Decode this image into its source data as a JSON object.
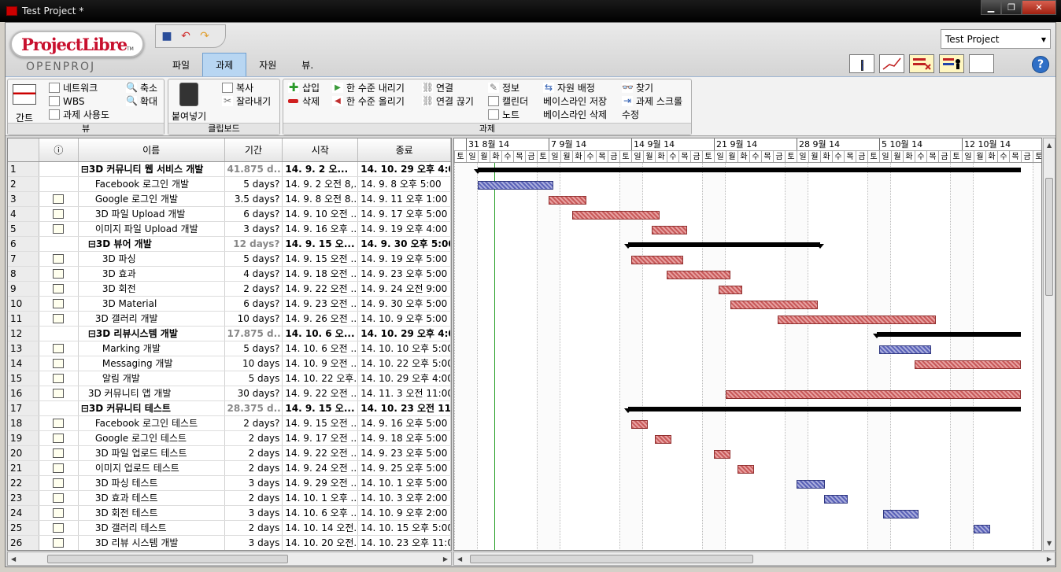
{
  "window": {
    "title": "Test Project *",
    "min": "▁",
    "max": "❐",
    "close": "✕"
  },
  "logo": {
    "name": "ProjectLibre",
    "tm": "TM",
    "sub": "OPENPROJ"
  },
  "tabs": [
    {
      "label": "파일"
    },
    {
      "label": "과제"
    },
    {
      "label": "자원"
    },
    {
      "label": "뷰."
    }
  ],
  "project_selector": {
    "value": "Test Project"
  },
  "help_label": "?",
  "ribbon": {
    "view_group": {
      "label": "뷰",
      "gantt": "간트",
      "network": "네트워크",
      "wbs": "WBS",
      "task_usage": "과제 사용도",
      "zoom_out": "축소",
      "zoom_in": "확대"
    },
    "clipboard_group": {
      "label": "클립보드",
      "paste": "붙여넣기",
      "copy": "복사",
      "cut": "잘라내기"
    },
    "task_group": {
      "label": "과제",
      "insert": "삽입",
      "delete": "삭제",
      "indent": "한 수준 내리기",
      "outdent": "한 수준 올리기",
      "link": "연결",
      "unlink": "연결 끊기",
      "info": "정보",
      "calendar": "캘린더",
      "notes": "노트",
      "assign": "자원 배정",
      "save_baseline": "베이스라인 저장",
      "clear_baseline": "베이스라인 삭제",
      "find": "찾기",
      "scroll_to_task": "과제 스크롤",
      "edit": "수정"
    }
  },
  "table": {
    "headers": {
      "info": "ⓘ",
      "name": "이름",
      "duration": "기간",
      "start": "시작",
      "finish": "종료"
    },
    "rows": [
      {
        "id": "1",
        "name": "⊟3D 커뮤니티 웹 서비스 개발",
        "duration": "41.875 d...",
        "start": "14. 9. 2 오...",
        "finish": "14. 10. 29 오후 4:0",
        "summary": true,
        "indent": 0,
        "note": false
      },
      {
        "id": "2",
        "name": "Facebook 로그인 개발",
        "duration": "5 days?",
        "start": "14. 9. 2 오전 8,...",
        "finish": "14. 9. 8 오후 5:00",
        "summary": false,
        "indent": 2,
        "note": false
      },
      {
        "id": "3",
        "name": "Google 로그인 개발",
        "duration": "3.5 days?",
        "start": "14. 9. 8 오전 8...",
        "finish": "14. 9. 11 오후 1:00",
        "summary": false,
        "indent": 2,
        "note": true
      },
      {
        "id": "4",
        "name": "3D 파일 Upload 개발",
        "duration": "6 days?",
        "start": "14. 9. 10 오전 ...",
        "finish": "14. 9. 17 오후 5:00",
        "summary": false,
        "indent": 2,
        "note": true
      },
      {
        "id": "5",
        "name": "이미지 파일 Upload 개발",
        "duration": "3 days?",
        "start": "14. 9. 16 오후 ...",
        "finish": "14. 9. 19 오후 4:00",
        "summary": false,
        "indent": 2,
        "note": true
      },
      {
        "id": "6",
        "name": "⊟3D 뷰어 개발",
        "duration": "12 days?",
        "start": "14. 9. 15 오...",
        "finish": "14. 9. 30 오후 5:00",
        "summary": true,
        "indent": 1,
        "note": false
      },
      {
        "id": "7",
        "name": "3D 파싱",
        "duration": "5 days?",
        "start": "14. 9. 15 오전 ...",
        "finish": "14. 9. 19 오후 5:00",
        "summary": false,
        "indent": 3,
        "note": true
      },
      {
        "id": "8",
        "name": "3D 효과",
        "duration": "4 days?",
        "start": "14. 9. 18 오전 ...",
        "finish": "14. 9. 23 오후 5:00",
        "summary": false,
        "indent": 3,
        "note": true
      },
      {
        "id": "9",
        "name": "3D 회전",
        "duration": "2 days?",
        "start": "14. 9. 22 오전 ...",
        "finish": "14. 9. 24 오전 9:00",
        "summary": false,
        "indent": 3,
        "note": true
      },
      {
        "id": "10",
        "name": "3D Material",
        "duration": "6 days?",
        "start": "14. 9. 23 오전 ...",
        "finish": "14. 9. 30 오후 5:00",
        "summary": false,
        "indent": 3,
        "note": true
      },
      {
        "id": "11",
        "name": "3D 갤러리 개발",
        "duration": "10 days?",
        "start": "14. 9. 26 오전 ...",
        "finish": "14. 10. 9 오후 5:00",
        "summary": false,
        "indent": 2,
        "note": true
      },
      {
        "id": "12",
        "name": "⊟3D 리뷰시스템 개발",
        "duration": "17.875 d...",
        "start": "14. 10. 6 오...",
        "finish": "14. 10. 29 오후 4:0",
        "summary": true,
        "indent": 1,
        "note": false
      },
      {
        "id": "13",
        "name": "Marking 개발",
        "duration": "5 days?",
        "start": "14. 10. 6 오전 ...",
        "finish": "14. 10. 10 오후 5:00",
        "summary": false,
        "indent": 3,
        "note": true
      },
      {
        "id": "14",
        "name": "Messaging 개발",
        "duration": "10 days",
        "start": "14. 10. 9 오전 ...",
        "finish": "14. 10. 22 오후 5:00",
        "summary": false,
        "indent": 3,
        "note": true
      },
      {
        "id": "15",
        "name": "알림 개발",
        "duration": "5 days",
        "start": "14. 10. 22 오후...",
        "finish": "14. 10. 29 오후 4:00",
        "summary": false,
        "indent": 3,
        "note": true
      },
      {
        "id": "16",
        "name": "3D 커뮤니티 앱 개발",
        "duration": "30 days?",
        "start": "14. 9. 22 오전 ...",
        "finish": "14. 11. 3 오전 11:00",
        "summary": false,
        "indent": 1,
        "note": true
      },
      {
        "id": "17",
        "name": "⊟3D 커뮤니티 테스트",
        "duration": "28.375 d...",
        "start": "14. 9. 15 오...",
        "finish": "14. 10. 23 오전 11",
        "summary": true,
        "indent": 0,
        "note": false
      },
      {
        "id": "18",
        "name": "Facebook 로그인 테스트",
        "duration": "2 days?",
        "start": "14. 9. 15 오전 ...",
        "finish": "14. 9. 16 오후 5:00",
        "summary": false,
        "indent": 2,
        "note": true
      },
      {
        "id": "19",
        "name": "Google 로그인 테스트",
        "duration": "2 days",
        "start": "14. 9. 17 오전 ...",
        "finish": "14. 9. 18 오후 5:00",
        "summary": false,
        "indent": 2,
        "note": true
      },
      {
        "id": "20",
        "name": "3D 파일 업로드 테스트",
        "duration": "2 days",
        "start": "14. 9. 22 오전 ...",
        "finish": "14. 9. 23 오후 5:00",
        "summary": false,
        "indent": 2,
        "note": true
      },
      {
        "id": "21",
        "name": "이미지 업로드 테스트",
        "duration": "2 days",
        "start": "14. 9. 24 오전 ...",
        "finish": "14. 9. 25 오후 5:00",
        "summary": false,
        "indent": 2,
        "note": true
      },
      {
        "id": "22",
        "name": "3D 파싱 테스트",
        "duration": "3 days",
        "start": "14. 9. 29 오전 ...",
        "finish": "14. 10. 1 오후 5:00",
        "summary": false,
        "indent": 2,
        "note": true
      },
      {
        "id": "23",
        "name": "3D 효과 테스트",
        "duration": "2 days",
        "start": "14. 10. 1 오후 ...",
        "finish": "14. 10. 3 오후 2:00",
        "summary": false,
        "indent": 2,
        "note": true
      },
      {
        "id": "24",
        "name": "3D 회전 테스트",
        "duration": "3 days",
        "start": "14. 10. 6 오후 ...",
        "finish": "14. 10. 9 오후 2:00",
        "summary": false,
        "indent": 2,
        "note": true
      },
      {
        "id": "25",
        "name": "3D 갤러리 테스트",
        "duration": "2 days",
        "start": "14. 10. 14 오전...",
        "finish": "14. 10. 15 오후 5:00",
        "summary": false,
        "indent": 2,
        "note": true
      },
      {
        "id": "26",
        "name": "3D 리뷰 시스템 개발",
        "duration": "3 days",
        "start": "14. 10. 20 오전...",
        "finish": "14. 10. 23 오후 11:00",
        "summary": false,
        "indent": 2,
        "note": true
      }
    ]
  },
  "gantt": {
    "weeks": [
      "31 8월 14",
      "7 9월 14",
      "14 9월 14",
      "21 9월 14",
      "28 9월 14",
      "5 10월 14",
      "12 10월 14"
    ],
    "days": [
      "토",
      "일",
      "월",
      "화",
      "수",
      "목",
      "금",
      "토",
      "일",
      "월",
      "화",
      "수",
      "목",
      "금",
      "토",
      "일",
      "월",
      "화",
      "수",
      "목",
      "금",
      "토",
      "일",
      "월",
      "화",
      "수",
      "목",
      "금",
      "토",
      "일",
      "월",
      "화",
      "수",
      "목",
      "금",
      "토",
      "일",
      "월",
      "화",
      "수",
      "목",
      "금",
      "토",
      "일",
      "월",
      "화",
      "수",
      "목",
      "금",
      "토"
    ],
    "bars": [
      {
        "row": 0,
        "type": "summary",
        "start": 2.0,
        "end": 48.0
      },
      {
        "row": 1,
        "type": "blue",
        "start": 2.0,
        "end": 8.4
      },
      {
        "row": 2,
        "type": "red",
        "start": 8.0,
        "end": 11.2
      },
      {
        "row": 3,
        "type": "red",
        "start": 10.0,
        "end": 17.4
      },
      {
        "row": 4,
        "type": "red",
        "start": 16.7,
        "end": 19.7
      },
      {
        "row": 5,
        "type": "summary",
        "start": 14.7,
        "end": 31.0
      },
      {
        "row": 6,
        "type": "red",
        "start": 15.0,
        "end": 19.4
      },
      {
        "row": 7,
        "type": "red",
        "start": 18.0,
        "end": 23.4
      },
      {
        "row": 8,
        "type": "red",
        "start": 22.4,
        "end": 24.4
      },
      {
        "row": 9,
        "type": "red",
        "start": 23.4,
        "end": 30.8
      },
      {
        "row": 10,
        "type": "red",
        "start": 27.4,
        "end": 40.8
      },
      {
        "row": 11,
        "type": "summary",
        "start": 35.8,
        "end": 48.0
      },
      {
        "row": 12,
        "type": "blue",
        "start": 36.0,
        "end": 40.4
      },
      {
        "row": 13,
        "type": "red",
        "start": 39.0,
        "end": 48.0
      },
      {
        "row": 15,
        "type": "red",
        "start": 23.0,
        "end": 48.0
      },
      {
        "row": 16,
        "type": "summary",
        "start": 14.7,
        "end": 48.0
      },
      {
        "row": 17,
        "type": "red",
        "start": 15.0,
        "end": 16.4
      },
      {
        "row": 18,
        "type": "red",
        "start": 17.0,
        "end": 18.4
      },
      {
        "row": 19,
        "type": "red",
        "start": 22.0,
        "end": 23.4
      },
      {
        "row": 20,
        "type": "red",
        "start": 24.0,
        "end": 25.4
      },
      {
        "row": 21,
        "type": "blue",
        "start": 29.0,
        "end": 31.4
      },
      {
        "row": 22,
        "type": "blue",
        "start": 31.3,
        "end": 33.3
      },
      {
        "row": 23,
        "type": "blue",
        "start": 36.3,
        "end": 39.3
      },
      {
        "row": 24,
        "type": "blue",
        "start": 44.0,
        "end": 45.4
      }
    ]
  }
}
